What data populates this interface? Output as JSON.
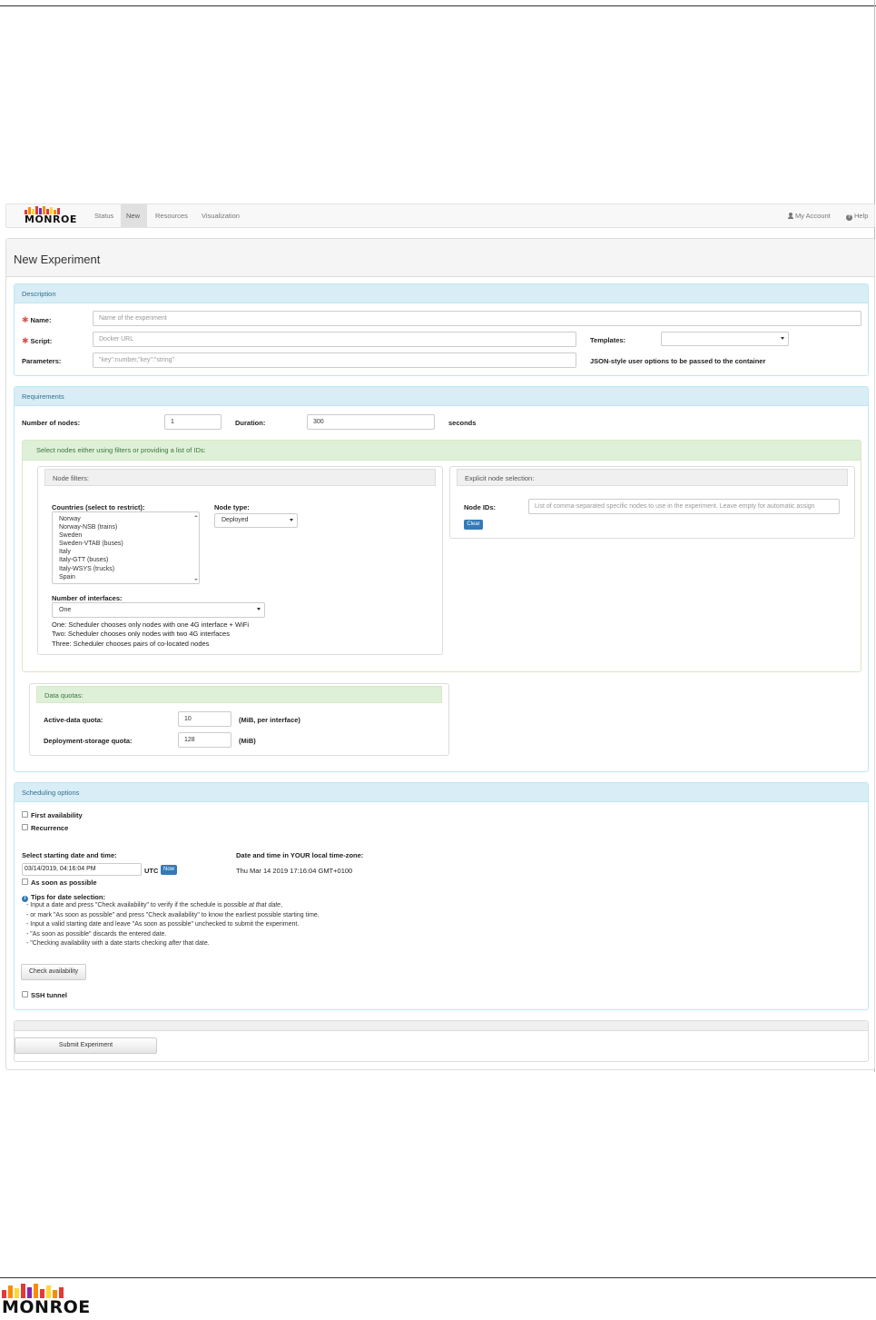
{
  "nav": {
    "brand": "MONROE",
    "items": [
      "Status",
      "New",
      "Resources",
      "Visualization"
    ],
    "active": "New",
    "account": "My Account",
    "help": "Help"
  },
  "page_title": "New Experiment",
  "description": {
    "heading": "Description",
    "name_label": "Name:",
    "name_placeholder": "Name of the experiment",
    "script_label": "Script:",
    "script_placeholder": "Docker URL",
    "templates_label": "Templates:",
    "templates_value": "",
    "parameters_label": "Parameters:",
    "parameters_placeholder": "\"key\":number,\"key\":\"string\"",
    "parameters_help": "JSON-style user options to be passed to the container"
  },
  "requirements": {
    "heading": "Requirements",
    "nodes_label": "Number of nodes:",
    "nodes_value": "1",
    "duration_label": "Duration:",
    "duration_value": "300",
    "duration_unit": "seconds",
    "select_heading": "Select nodes either using filters or providing a list of IDs:",
    "filters": {
      "heading": "Node filters:",
      "countries_label": "Countries (select to restrict):",
      "countries": [
        "Norway",
        "Norway-NSB (trains)",
        "Sweden",
        "Sweden-VTAB (buses)",
        "Italy",
        "Italy-GTT (buses)",
        "Italy-WSYS (trucks)",
        "Spain"
      ],
      "node_type_label": "Node type:",
      "node_type_value": "Deployed",
      "interfaces_label": "Number of interfaces:",
      "interfaces_value": "One",
      "interfaces_help": [
        "One: Scheduler chooses only nodes with one 4G interface + WiFi",
        "Two: Scheduler chooses only nodes with two 4G interfaces",
        "Three: Scheduler chooses pairs of co-located nodes"
      ]
    },
    "explicit": {
      "heading": "Explicit node selection:",
      "node_ids_label": "Node IDs:",
      "node_ids_placeholder": "List of comma-separated specific nodes to use in the experiment. Leave empty for automatic assign",
      "clear_label": "Clear"
    },
    "quotas": {
      "heading": "Data quotas:",
      "active_label": "Active-data quota:",
      "active_value": "10",
      "active_unit": "(MiB, per interface)",
      "storage_label": "Deployment-storage quota:",
      "storage_value": "128",
      "storage_unit": "(MiB)"
    }
  },
  "scheduling": {
    "heading": "Scheduling options",
    "first_availability": "First availability",
    "recurrence": "Recurrence",
    "start_label": "Select starting date and time:",
    "start_value": "03/14/2019, 04:16:04 PM",
    "utc": "UTC",
    "now_label": "Now",
    "local_label": "Date and time in YOUR local time-zone:",
    "local_value": "Thu Mar 14 2019 17:16:04 GMT+0100",
    "asap": "As soon as possible",
    "tips_title": "Tips for date selection:",
    "tips": {
      "t1a": "- Input a date and press \"Check availability\" to verify if the schedule is possible ",
      "t1b": "at that date",
      "t1c": ",",
      "t2": "- or mark \"As soon as possible\" and press \"Check availability\" to know the earliest possible starting time.",
      "t3": "- Input a valid starting date and leave \"As soon as possible\" unchecked to submit the experiment.",
      "t4": "- \"As soon as possible\" discards the entered date.",
      "t5a": "- \"Checking availability with a date starts checking ",
      "t5b": "after",
      "t5c": " that date."
    },
    "check_label": "Check availability",
    "ssh_label": "SSH tunnel"
  },
  "submit_label": "Submit Experiment",
  "colors": {
    "accent_blue": "#337ab7",
    "info_heading": "#d9edf7",
    "success_heading": "#dff0d8",
    "required_star": "#d9534f"
  }
}
